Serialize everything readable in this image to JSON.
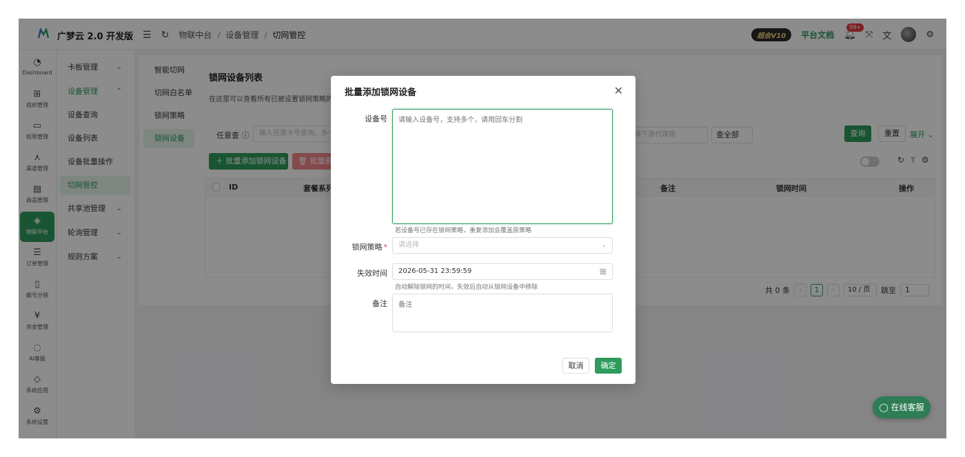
{
  "brand": {
    "name": "广梦云 2.0 开发版",
    "logo_color": "#2e9b5d"
  },
  "breadcrumb": [
    "物联中台",
    "设备管理",
    "切网管控"
  ],
  "topbar": {
    "vip_label": "超会V10",
    "doc_link": "平台文档",
    "notif_badge": "99+"
  },
  "rail": [
    {
      "label": "Dashboard",
      "icon": "dashboard-icon",
      "glyph": "◔"
    },
    {
      "label": "组织管理",
      "icon": "grid-icon",
      "glyph": "⊞"
    },
    {
      "label": "权限管理",
      "icon": "monitor-icon",
      "glyph": "▭"
    },
    {
      "label": "渠道管理",
      "icon": "nodes-icon",
      "glyph": "⋏"
    },
    {
      "label": "商品管理",
      "icon": "store-icon",
      "glyph": "▤"
    },
    {
      "label": "物联中台",
      "icon": "cube-icon",
      "glyph": "◈"
    },
    {
      "label": "订单管理",
      "icon": "list-icon",
      "glyph": "☰"
    },
    {
      "label": "靓号分销",
      "icon": "phone-icon",
      "glyph": "▯"
    },
    {
      "label": "资金管理",
      "icon": "money-icon",
      "glyph": "¥"
    },
    {
      "label": "AI客服",
      "icon": "ai-icon",
      "glyph": "◌"
    },
    {
      "label": "系统应用",
      "icon": "box-icon",
      "glyph": "◇"
    },
    {
      "label": "系统设置",
      "icon": "gear-icon",
      "glyph": "⚙"
    }
  ],
  "submenu": [
    {
      "label": "卡板管理",
      "chev": "⌄"
    },
    {
      "label": "设备管理",
      "chev": "⌃"
    },
    {
      "label": "设备查询",
      "chev": ""
    },
    {
      "label": "设备列表",
      "chev": ""
    },
    {
      "label": "设备批量操作",
      "chev": ""
    },
    {
      "label": "切网管控",
      "chev": ""
    },
    {
      "label": "共享池管理",
      "chev": "⌄"
    },
    {
      "label": "轮询管理",
      "chev": "⌄"
    },
    {
      "label": "规则方案",
      "chev": "⌄"
    }
  ],
  "tabs": [
    "智能切网",
    "切网白名单",
    "锁网策略",
    "锁网设备"
  ],
  "page": {
    "title": "锁网设备列表",
    "desc": "在这里可以查看所有已被设置锁网策略的"
  },
  "filter": {
    "label": "任意查",
    "input_placeholder": "输入任意卡号查询，多个",
    "agent_placeholder": "择下游代理商",
    "scope": "查全部",
    "query": "查询",
    "reset": "重置",
    "expand": "展开"
  },
  "actions": {
    "add": "批量添加锁网设备",
    "delete": "批量删"
  },
  "table": {
    "headers": [
      "ID",
      "套餐系列",
      "备注",
      "锁网时间",
      "操作"
    ]
  },
  "pager": {
    "total": "共 0 条",
    "current": "1",
    "size": "10 / 页",
    "jump_label": "跳至",
    "jump_value": "1"
  },
  "modal": {
    "title": "批量添加锁网设备",
    "device_label": "设备号",
    "device_placeholder": "请输入设备号，支持多个，请用回车分割",
    "device_help": "若设备号已存在锁网策略，重复添加会覆盖原策略",
    "policy_label": "锁网策略",
    "policy_placeholder": "请选择",
    "expire_label": "失效时间",
    "expire_value": "2026-05-31 23:59:59",
    "expire_help": "自动解除锁网的时间，失效后自动从锁网设备中移除",
    "note_label": "备注",
    "note_placeholder": "备注",
    "cancel": "取消",
    "ok": "确定"
  },
  "chat": {
    "label": "在线客服"
  },
  "colors": {
    "primary": "#2e9b5d",
    "danger": "#e6393d",
    "overlay": "rgba(0,0,0,0.45)"
  }
}
